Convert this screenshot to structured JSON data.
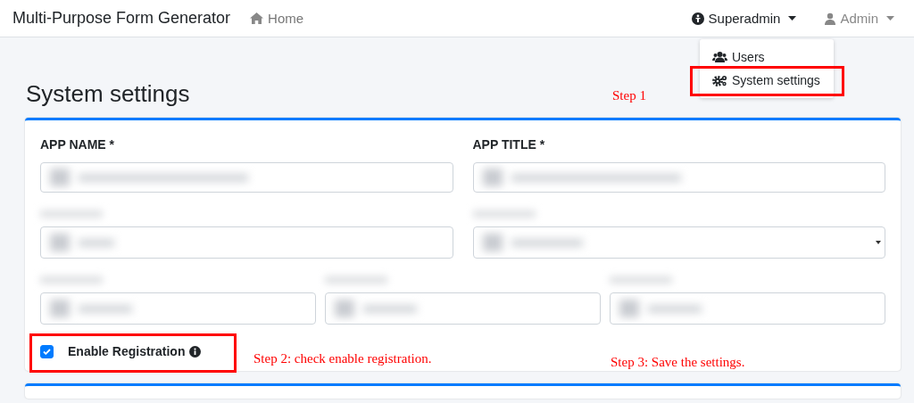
{
  "navbar": {
    "brand": "Multi-Purpose Form Generator",
    "home": "Home",
    "menus": [
      {
        "label": "Superadmin",
        "expanded": true
      },
      {
        "label": "Admin",
        "expanded": false
      }
    ]
  },
  "dropdown": {
    "items": [
      {
        "label": "Users",
        "highlighted": false
      },
      {
        "label": "System settings",
        "highlighted": true
      }
    ]
  },
  "page_title": "System settings",
  "settings_card": {
    "fields": [
      {
        "label": "APP NAME *"
      },
      {
        "label": "APP TITLE *"
      }
    ],
    "registration": {
      "label": "Enable Registration",
      "checked": true,
      "highlighted": true
    }
  },
  "annotations": [
    {
      "text": "Step 1"
    },
    {
      "text": "Step 2: check enable registration."
    },
    {
      "text": "Step 3: Save the settings."
    }
  ]
}
